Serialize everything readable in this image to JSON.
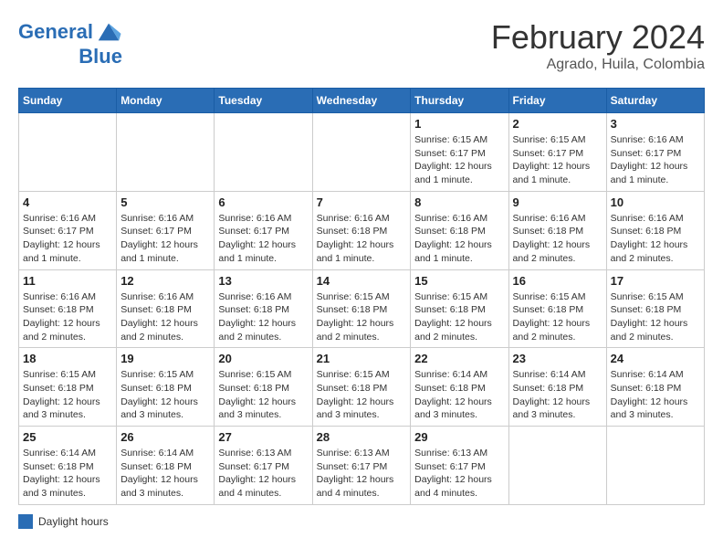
{
  "logo": {
    "line1": "General",
    "line2": "Blue"
  },
  "title": "February 2024",
  "subtitle": "Agrado, Huila, Colombia",
  "days_of_week": [
    "Sunday",
    "Monday",
    "Tuesday",
    "Wednesday",
    "Thursday",
    "Friday",
    "Saturday"
  ],
  "weeks": [
    [
      {
        "day": "",
        "info": ""
      },
      {
        "day": "",
        "info": ""
      },
      {
        "day": "",
        "info": ""
      },
      {
        "day": "",
        "info": ""
      },
      {
        "day": "1",
        "info": "Sunrise: 6:15 AM\nSunset: 6:17 PM\nDaylight: 12 hours\nand 1 minute."
      },
      {
        "day": "2",
        "info": "Sunrise: 6:15 AM\nSunset: 6:17 PM\nDaylight: 12 hours\nand 1 minute."
      },
      {
        "day": "3",
        "info": "Sunrise: 6:16 AM\nSunset: 6:17 PM\nDaylight: 12 hours\nand 1 minute."
      }
    ],
    [
      {
        "day": "4",
        "info": "Sunrise: 6:16 AM\nSunset: 6:17 PM\nDaylight: 12 hours\nand 1 minute."
      },
      {
        "day": "5",
        "info": "Sunrise: 6:16 AM\nSunset: 6:17 PM\nDaylight: 12 hours\nand 1 minute."
      },
      {
        "day": "6",
        "info": "Sunrise: 6:16 AM\nSunset: 6:17 PM\nDaylight: 12 hours\nand 1 minute."
      },
      {
        "day": "7",
        "info": "Sunrise: 6:16 AM\nSunset: 6:18 PM\nDaylight: 12 hours\nand 1 minute."
      },
      {
        "day": "8",
        "info": "Sunrise: 6:16 AM\nSunset: 6:18 PM\nDaylight: 12 hours\nand 1 minute."
      },
      {
        "day": "9",
        "info": "Sunrise: 6:16 AM\nSunset: 6:18 PM\nDaylight: 12 hours\nand 2 minutes."
      },
      {
        "day": "10",
        "info": "Sunrise: 6:16 AM\nSunset: 6:18 PM\nDaylight: 12 hours\nand 2 minutes."
      }
    ],
    [
      {
        "day": "11",
        "info": "Sunrise: 6:16 AM\nSunset: 6:18 PM\nDaylight: 12 hours\nand 2 minutes."
      },
      {
        "day": "12",
        "info": "Sunrise: 6:16 AM\nSunset: 6:18 PM\nDaylight: 12 hours\nand 2 minutes."
      },
      {
        "day": "13",
        "info": "Sunrise: 6:16 AM\nSunset: 6:18 PM\nDaylight: 12 hours\nand 2 minutes."
      },
      {
        "day": "14",
        "info": "Sunrise: 6:15 AM\nSunset: 6:18 PM\nDaylight: 12 hours\nand 2 minutes."
      },
      {
        "day": "15",
        "info": "Sunrise: 6:15 AM\nSunset: 6:18 PM\nDaylight: 12 hours\nand 2 minutes."
      },
      {
        "day": "16",
        "info": "Sunrise: 6:15 AM\nSunset: 6:18 PM\nDaylight: 12 hours\nand 2 minutes."
      },
      {
        "day": "17",
        "info": "Sunrise: 6:15 AM\nSunset: 6:18 PM\nDaylight: 12 hours\nand 2 minutes."
      }
    ],
    [
      {
        "day": "18",
        "info": "Sunrise: 6:15 AM\nSunset: 6:18 PM\nDaylight: 12 hours\nand 3 minutes."
      },
      {
        "day": "19",
        "info": "Sunrise: 6:15 AM\nSunset: 6:18 PM\nDaylight: 12 hours\nand 3 minutes."
      },
      {
        "day": "20",
        "info": "Sunrise: 6:15 AM\nSunset: 6:18 PM\nDaylight: 12 hours\nand 3 minutes."
      },
      {
        "day": "21",
        "info": "Sunrise: 6:15 AM\nSunset: 6:18 PM\nDaylight: 12 hours\nand 3 minutes."
      },
      {
        "day": "22",
        "info": "Sunrise: 6:14 AM\nSunset: 6:18 PM\nDaylight: 12 hours\nand 3 minutes."
      },
      {
        "day": "23",
        "info": "Sunrise: 6:14 AM\nSunset: 6:18 PM\nDaylight: 12 hours\nand 3 minutes."
      },
      {
        "day": "24",
        "info": "Sunrise: 6:14 AM\nSunset: 6:18 PM\nDaylight: 12 hours\nand 3 minutes."
      }
    ],
    [
      {
        "day": "25",
        "info": "Sunrise: 6:14 AM\nSunset: 6:18 PM\nDaylight: 12 hours\nand 3 minutes."
      },
      {
        "day": "26",
        "info": "Sunrise: 6:14 AM\nSunset: 6:18 PM\nDaylight: 12 hours\nand 3 minutes."
      },
      {
        "day": "27",
        "info": "Sunrise: 6:13 AM\nSunset: 6:17 PM\nDaylight: 12 hours\nand 4 minutes."
      },
      {
        "day": "28",
        "info": "Sunrise: 6:13 AM\nSunset: 6:17 PM\nDaylight: 12 hours\nand 4 minutes."
      },
      {
        "day": "29",
        "info": "Sunrise: 6:13 AM\nSunset: 6:17 PM\nDaylight: 12 hours\nand 4 minutes."
      },
      {
        "day": "",
        "info": ""
      },
      {
        "day": "",
        "info": ""
      }
    ]
  ],
  "legend": {
    "box_color": "#2a6db5",
    "label": "Daylight hours"
  }
}
